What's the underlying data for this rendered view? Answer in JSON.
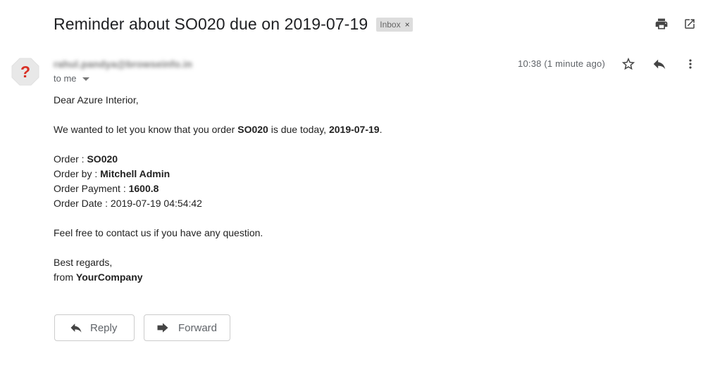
{
  "header": {
    "subject": "Reminder about SO020 due on 2019-07-19",
    "label_chip": "Inbox",
    "label_chip_close": "×",
    "print_icon": "print-icon",
    "open_new_window_icon": "open-in-new-window-icon"
  },
  "message": {
    "sender": "rahul.pandya@browseinfo.in",
    "recipient": "to me",
    "timestamp": "10:38 (1 minute ago)",
    "avatar_glyph": "?",
    "avatar_color": "#e8e8e8",
    "avatar_glyph_color": "#d93025",
    "actions": {
      "star_icon": "star-outline-icon",
      "reply_icon": "reply-icon",
      "more_icon": "more-vertical-icon"
    }
  },
  "body": {
    "greeting": "Dear Azure Interior,",
    "intro_prefix": "We wanted to let you know that you order ",
    "intro_order": "SO020",
    "intro_middle": " is due today, ",
    "intro_date": "2019-07-19",
    "intro_suffix": ".",
    "order_label": "Order : ",
    "order_value": "SO020",
    "order_by_label": "Order by : ",
    "order_by_value": "Mitchell Admin",
    "payment_label": "Order Payment : ",
    "payment_value": "1600.8",
    "date_label": "Order Date : ",
    "date_value": "2019-07-19 04:54:42",
    "contact_line": "Feel free to contact us if you have any question.",
    "regards": "Best regards,",
    "from_prefix": "from ",
    "from_company": "YourCompany"
  },
  "footer_buttons": {
    "reply_label": "Reply",
    "forward_label": "Forward"
  }
}
